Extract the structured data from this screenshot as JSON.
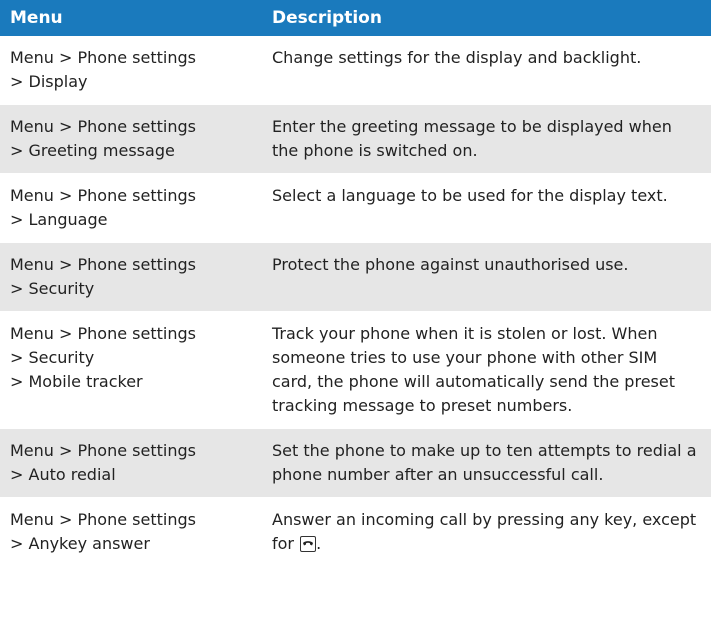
{
  "header": {
    "menu_label": "Menu",
    "description_label": "Description"
  },
  "rows": [
    {
      "path": [
        "Menu > Phone settings",
        "> Display"
      ],
      "description": "Change settings for the display and backlight."
    },
    {
      "path": [
        "Menu > Phone settings",
        "> Greeting message"
      ],
      "description": "Enter the greeting message to be displayed when the phone is switched on."
    },
    {
      "path": [
        "Menu > Phone settings",
        "> Language"
      ],
      "description": "Select a language to be used for the display text."
    },
    {
      "path": [
        "Menu > Phone settings",
        "> Security"
      ],
      "description": "Protect the phone against unauthorised use."
    },
    {
      "path": [
        "Menu > Phone settings",
        "> Security",
        "> Mobile tracker"
      ],
      "description": "Track your phone when it is stolen or lost. When someone tries to use your phone with other SIM card, the phone will automatically send the preset tracking message to preset numbers."
    },
    {
      "path": [
        "Menu > Phone settings",
        "> Auto redial"
      ],
      "description": "Set the phone to make up to ten attempts to redial a phone number after an unsuccessful call."
    },
    {
      "path": [
        "Menu > Phone settings",
        "> Anykey answer"
      ],
      "description": "Answer an incoming call by pressing any key, except for",
      "description_suffix": ".",
      "icon": "end-call-key-icon"
    }
  ],
  "colors": {
    "header_bg": "#1a7abd",
    "header_text": "#ffffff",
    "row_shade": "#e6e6e6"
  }
}
